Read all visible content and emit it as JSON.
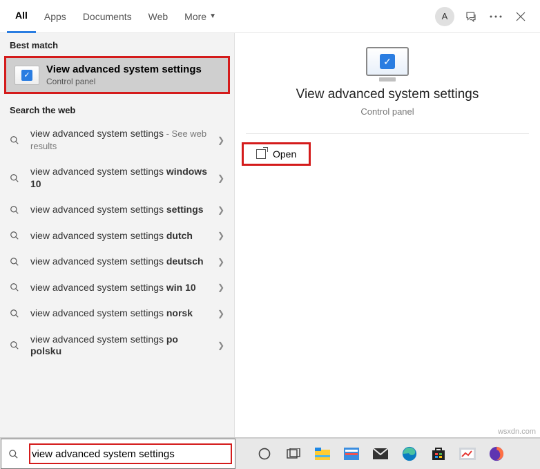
{
  "tabs": {
    "all": "All",
    "apps": "Apps",
    "documents": "Documents",
    "web": "Web",
    "more": "More"
  },
  "header": {
    "avatar_letter": "A"
  },
  "sections": {
    "best_match": "Best match",
    "search_web": "Search the web"
  },
  "best_match": {
    "title": "View advanced system settings",
    "subtitle": "Control panel"
  },
  "web_results": [
    {
      "prefix": "view advanced system settings",
      "bold": "",
      "suffix": " - See web results"
    },
    {
      "prefix": "view advanced system settings ",
      "bold": "windows 10",
      "suffix": ""
    },
    {
      "prefix": "view advanced system settings ",
      "bold": "settings",
      "suffix": ""
    },
    {
      "prefix": "view advanced system settings ",
      "bold": "dutch",
      "suffix": ""
    },
    {
      "prefix": "view advanced system settings ",
      "bold": "deutsch",
      "suffix": ""
    },
    {
      "prefix": "view advanced system settings ",
      "bold": "win 10",
      "suffix": ""
    },
    {
      "prefix": "view advanced system settings ",
      "bold": "norsk",
      "suffix": ""
    },
    {
      "prefix": "view advanced system settings ",
      "bold": "po polsku",
      "suffix": ""
    }
  ],
  "preview": {
    "title": "View advanced system settings",
    "subtitle": "Control panel",
    "open_label": "Open"
  },
  "search_input": {
    "value": "view advanced system settings"
  },
  "watermark": "wsxdn.com"
}
